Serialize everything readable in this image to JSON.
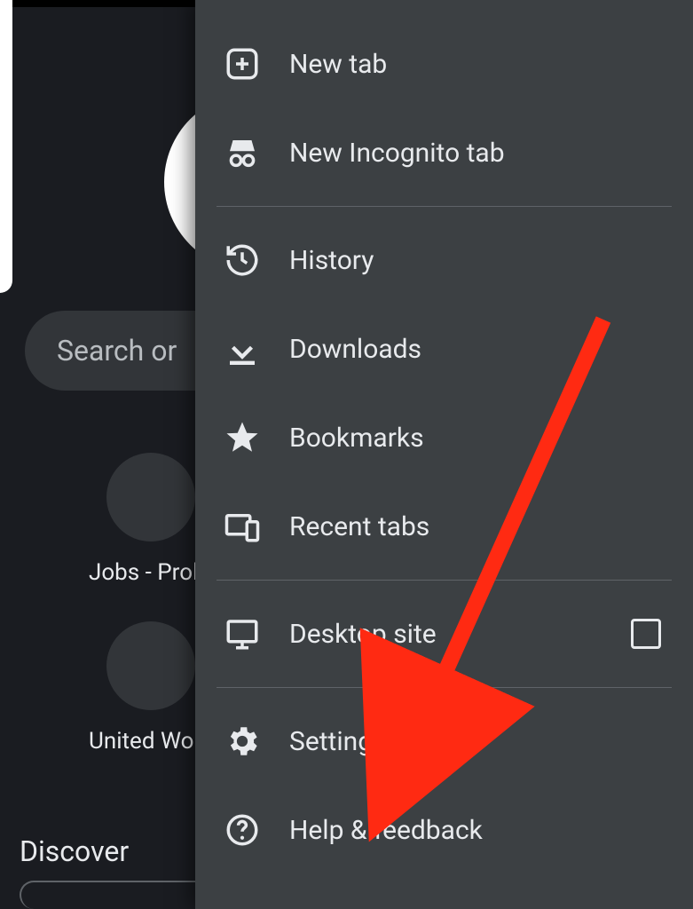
{
  "background": {
    "search_placeholder": "Search or ",
    "chip_labels": [
      "Jobs - Prol",
      "United Wor"
    ],
    "discover_label": "Discover"
  },
  "menu": {
    "items": [
      {
        "label": "New tab",
        "icon": "plus-square"
      },
      {
        "label": "New Incognito tab",
        "icon": "incognito"
      },
      {
        "label": "History",
        "icon": "history"
      },
      {
        "label": "Downloads",
        "icon": "download"
      },
      {
        "label": "Bookmarks",
        "icon": "star"
      },
      {
        "label": "Recent tabs",
        "icon": "devices"
      },
      {
        "label": "Desktop site",
        "icon": "desktop",
        "checkbox": true
      },
      {
        "label": "Settings",
        "icon": "gear"
      },
      {
        "label": "Help & feedback",
        "icon": "help"
      }
    ]
  }
}
